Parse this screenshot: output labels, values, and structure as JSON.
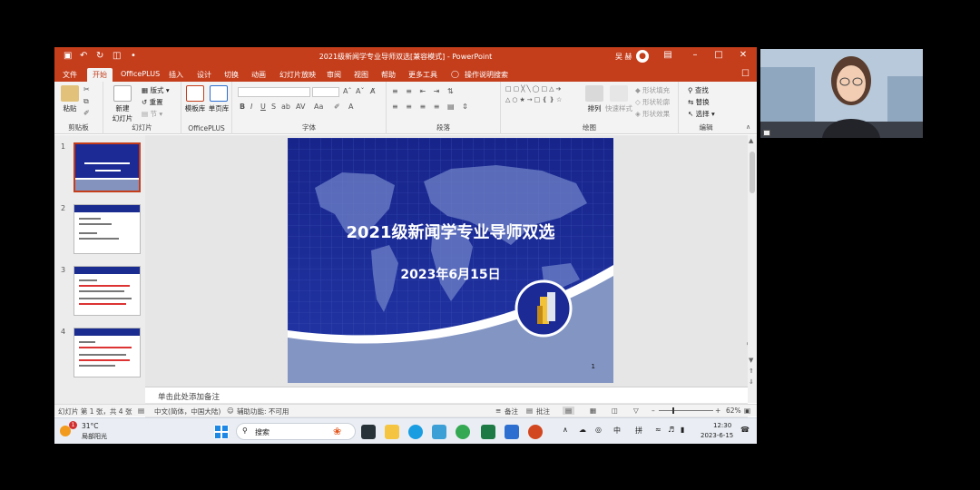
{
  "titlebar": {
    "title": "2021级新闻学专业导师双选[兼容模式] - PowerPoint",
    "user": "吴 赫",
    "avatar": "头像"
  },
  "tabs": [
    "文件",
    "开始",
    "OfficePLUS",
    "插入",
    "设计",
    "切换",
    "动画",
    "幻灯片放映",
    "审阅",
    "视图",
    "帮助",
    "更多工具",
    "操作说明搜索"
  ],
  "ribbon": {
    "paste": "粘贴",
    "clipboard": "剪贴板",
    "new_slide_1": "新建",
    "new_slide_2": "幻灯片",
    "layout": "版式",
    "reset": "重置",
    "section": "节",
    "slides": "幻灯片",
    "template_lib": "模板库",
    "single_page_lib": "单页库",
    "officeplus": "OfficePLUS",
    "font": "字体",
    "paragraph": "段落",
    "arrange": "排列",
    "quick_styles": "快速样式",
    "shape_fill": "形状填充",
    "shape_outline": "形状轮廓",
    "shape_effect": "形状效果",
    "drawing": "绘图",
    "find": "查找",
    "replace": "替换",
    "select": "选择",
    "editing": "编辑"
  },
  "thumbnails": [
    "1",
    "2",
    "3",
    "4"
  ],
  "slide": {
    "title": "2021级新闻学专业导师双选",
    "date": "2023年6月15日",
    "number": "1",
    "bg_color": "#1b2a95"
  },
  "notes_placeholder": "单击此处添加备注",
  "statusbar": {
    "slide_info": "幻灯片 第 1 张，共 4 张",
    "language": "中文(简体，中国大陆)",
    "accessibility": "辅助功能: 不可用",
    "notes": "备注",
    "comments": "批注",
    "zoom": "62%"
  },
  "taskbar": {
    "weather_temp": "31°C",
    "weather_text": "局部阳光",
    "weather_badge": "1",
    "search": "搜索",
    "ime_lang": "中",
    "ime_mode": "拼",
    "time": "12:30",
    "date": "2023-6-15"
  },
  "colors": {
    "ppt_accent": "#c43e1c",
    "slide_blue": "#1b2a95"
  }
}
